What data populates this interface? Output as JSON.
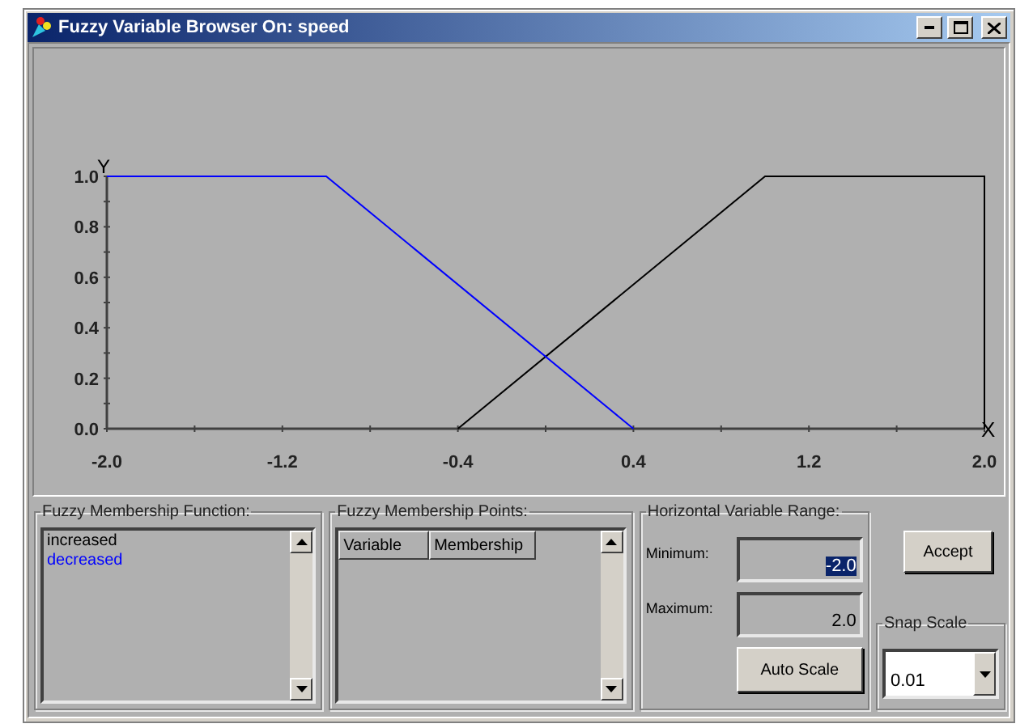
{
  "window": {
    "title": "Fuzzy Variable Browser On: speed"
  },
  "chart": {
    "chart_data": {
      "type": "line",
      "xlabel": "X",
      "ylabel": "Y",
      "x": [
        -2.0,
        -1.0,
        -0.4,
        0.4,
        1.0,
        2.0,
        2.0
      ],
      "series": [
        {
          "color": "#000000",
          "values": [
            null,
            null,
            0,
            null,
            1,
            1,
            0
          ]
        },
        {
          "color": "#0000ff",
          "values": [
            1,
            1,
            null,
            0,
            null,
            null,
            null
          ]
        }
      ],
      "xlim": [
        -2.0,
        2.0
      ],
      "ylim": [
        0,
        1
      ],
      "xticks": [
        {
          "value": -2.0,
          "label": "-2.0"
        },
        {
          "value": -1.2,
          "label": "-1.2"
        },
        {
          "value": -0.4,
          "label": "-0.4"
        },
        {
          "value": 0.4,
          "label": "0.4"
        },
        {
          "value": 1.2,
          "label": "1.2"
        },
        {
          "value": 2.0,
          "label": "2.0"
        }
      ],
      "yticks": [
        {
          "value": 0,
          "label": "0.0"
        },
        {
          "value": 0.2,
          "label": "0.2"
        },
        {
          "value": 0.4,
          "label": "0.4"
        },
        {
          "value": 0.6,
          "label": "0.6"
        },
        {
          "value": 0.8,
          "label": "0.8"
        },
        {
          "value": 1,
          "label": "1.0"
        }
      ]
    }
  },
  "membership_function": {
    "label": "Fuzzy Membership Function:",
    "items": [
      {
        "text": "increased",
        "color": "#000000"
      },
      {
        "text": "decreased",
        "color": "#0000ff"
      }
    ]
  },
  "membership_points": {
    "label": "Fuzzy Membership Points:",
    "columns": [
      "Variable",
      "Membership"
    ]
  },
  "range": {
    "label": "Horizontal Variable Range:",
    "minimum": {
      "label": "Minimum:",
      "value": "-2.0",
      "text_selected": true
    },
    "maximum": {
      "label": "Maximum:",
      "value": "2.0",
      "text_selected": false
    },
    "auto_button": "Auto Scale"
  },
  "accept_button": "Accept",
  "snap_scale": {
    "label": "Snap Scale",
    "value": "0.01"
  }
}
